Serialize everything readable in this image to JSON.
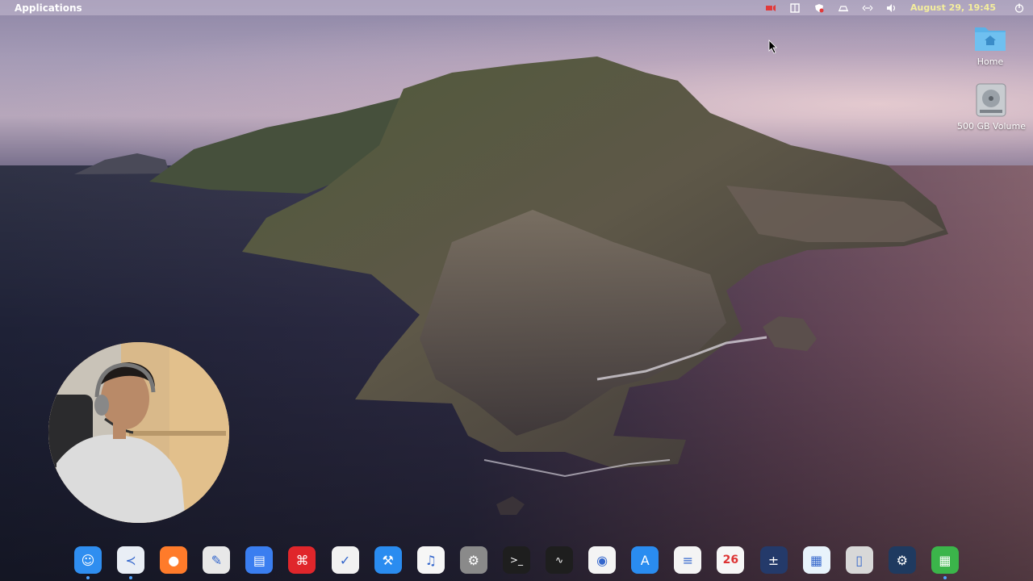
{
  "topbar": {
    "apple_glyph": "",
    "applications_label": "Applications",
    "clock": "August 29, 19:45",
    "tray_icons": [
      "record-icon",
      "window-icon",
      "shield-icon",
      "notification-icon",
      "network-icon",
      "volume-icon",
      "power-icon"
    ]
  },
  "desktop": {
    "icons": [
      {
        "label": "Home",
        "icon": "folder-home-icon"
      },
      {
        "label": "500 GB Volume",
        "icon": "hard-drive-icon"
      }
    ]
  },
  "dock": {
    "items": [
      {
        "name": "finder",
        "glyph": "☺",
        "color": "#2f8ef0",
        "running": true
      },
      {
        "name": "vscode",
        "glyph": "≺",
        "color": "#e9eef5",
        "running": true
      },
      {
        "name": "firefox",
        "glyph": "●",
        "color": "#ff7b2a",
        "running": false
      },
      {
        "name": "text-editor",
        "glyph": "✎",
        "color": "#e8e8e8",
        "running": false
      },
      {
        "name": "files",
        "glyph": "▤",
        "color": "#3a7ef0",
        "running": false
      },
      {
        "name": "pdf-reader",
        "glyph": "⌘",
        "color": "#e0262b",
        "running": false
      },
      {
        "name": "tasks",
        "glyph": "✓",
        "color": "#f2f2f2",
        "running": false
      },
      {
        "name": "xcode-tools",
        "glyph": "⚒",
        "color": "#2a8cf0",
        "running": false
      },
      {
        "name": "music",
        "glyph": "♫",
        "color": "#f6f6f6",
        "running": false
      },
      {
        "name": "system-preferences",
        "glyph": "⚙",
        "color": "#8a8a8a",
        "running": false
      },
      {
        "name": "terminal",
        "glyph": ">_",
        "color": "#1e1e1e",
        "running": false
      },
      {
        "name": "activity-monitor",
        "glyph": "∿",
        "color": "#1e1e1e",
        "running": false
      },
      {
        "name": "screenshot",
        "glyph": "◉",
        "color": "#f4f4f4",
        "running": false
      },
      {
        "name": "app-store",
        "glyph": "A",
        "color": "#2a8cf0",
        "running": false
      },
      {
        "name": "reminders",
        "glyph": "≡",
        "color": "#f4f4f4",
        "running": false
      },
      {
        "name": "calendar",
        "glyph": "26",
        "color": "#f6f6f6",
        "running": false
      },
      {
        "name": "calculator",
        "glyph": "±",
        "color": "#243a6a",
        "running": false
      },
      {
        "name": "document-viewer",
        "glyph": "▦",
        "color": "#e8f3fb",
        "running": false
      },
      {
        "name": "trash",
        "glyph": "▯",
        "color": "#d8d8d8",
        "running": false
      },
      {
        "name": "steam",
        "glyph": "⚙",
        "color": "#1f3a60",
        "running": false
      },
      {
        "name": "spreadsheet",
        "glyph": "▦",
        "color": "#3bb54a",
        "running": true
      }
    ]
  }
}
